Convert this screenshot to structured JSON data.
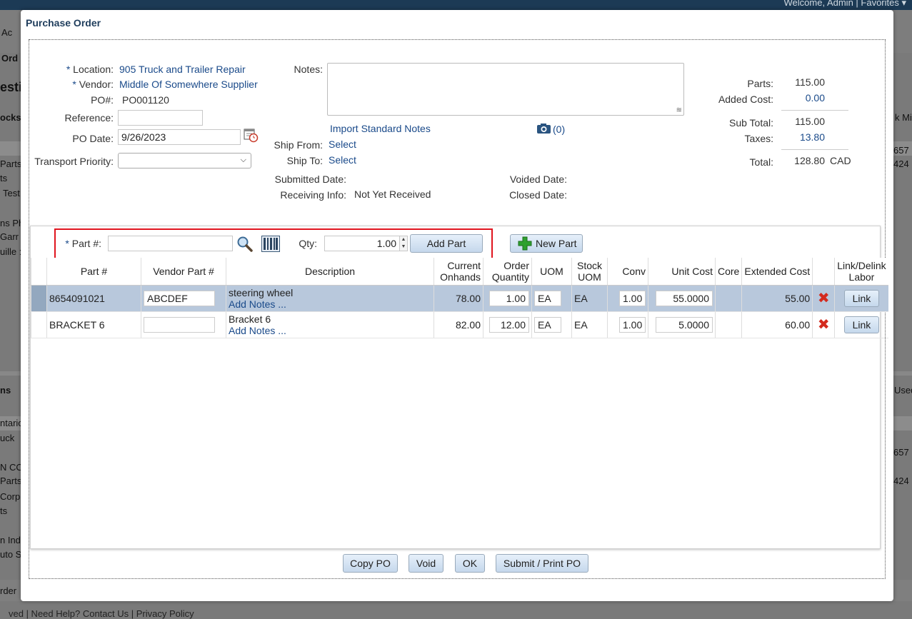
{
  "background": {
    "welcome": "Welcome, Admin  |  Favorites ▾",
    "left_texts": [
      "Ac",
      "Ord",
      "esti",
      "ocks",
      "Parts",
      "ts",
      "Test",
      "ns Ph",
      "Garr",
      "uille :",
      "ns",
      "ntario",
      "uck",
      "N CO",
      "Parts",
      "Corp",
      "ts",
      "n Ind",
      "uto S",
      "rder"
    ],
    "right_texts": [
      "k Mir",
      "657",
      "424",
      "Used",
      "657",
      "424"
    ],
    "footer": "ved  |  Need Help? Contact Us  |  Privacy Policy"
  },
  "dialog": {
    "title": "Purchase Order",
    "location_label": "Location:",
    "location_value": "905 Truck and Trailer Repair",
    "vendor_label": "Vendor:",
    "vendor_value": "Middle Of Somewhere Supplier",
    "po_label": "PO#:",
    "po_value": "PO001120",
    "reference_label": "Reference:",
    "reference_value": "",
    "po_date_label": "PO Date:",
    "po_date_value": "9/26/2023",
    "transport_label": "Transport Priority:",
    "transport_value": "",
    "notes_label": "Notes:",
    "notes_value": "",
    "import_notes": "Import Standard Notes",
    "attachments_count": "(0)",
    "ship_from_label": "Ship From:",
    "ship_from_value": "Select",
    "ship_to_label": "Ship To:",
    "ship_to_value": "Select",
    "submitted_label": "Submitted Date:",
    "submitted_value": "",
    "receiving_label": "Receiving Info:",
    "receiving_value": "Not Yet Received",
    "voided_label": "Voided Date:",
    "voided_value": "",
    "closed_label": "Closed Date:",
    "closed_value": "",
    "summary": {
      "parts_label": "Parts:",
      "parts_value": "115.00",
      "added_cost_label": "Added Cost:",
      "added_cost_value": "0.00",
      "subtotal_label": "Sub Total:",
      "subtotal_value": "115.00",
      "taxes_label": "Taxes:",
      "taxes_value": "13.80",
      "total_label": "Total:",
      "total_value": "128.80",
      "currency": "CAD"
    }
  },
  "part_entry": {
    "req_mark": "*",
    "part_label": "Part #:",
    "part_value": "",
    "qty_label": "Qty:",
    "qty_value": "1.00",
    "add_part": "Add Part",
    "new_part": "New Part"
  },
  "table": {
    "headers": {
      "part": "Part #",
      "vendor_part": "Vendor Part #",
      "description": "Description",
      "onhands_1": "Current",
      "onhands_2": "Onhands",
      "order_qty_1": "Order",
      "order_qty_2": "Quantity",
      "uom": "UOM",
      "stock_uom_1": "Stock",
      "stock_uom_2": "UOM",
      "conv": "Conv",
      "unit_cost": "Unit Cost",
      "core": "Core",
      "extended_cost": "Extended Cost",
      "link_1": "Link/Delink",
      "link_2": "Labor"
    },
    "rows": [
      {
        "part": "8654091021",
        "vendor_part": "ABCDEF",
        "description": "steering wheel",
        "add_notes": "Add Notes ...",
        "onhands": "78.00",
        "order_qty": "1.00",
        "uom": "EA",
        "stock_uom": "EA",
        "conv": "1.00",
        "unit_cost": "55.0000",
        "core": "",
        "extended": "55.00",
        "link": "Link"
      },
      {
        "part": "BRACKET 6",
        "vendor_part": "",
        "description": "Bracket 6",
        "add_notes": "Add Notes ...",
        "onhands": "82.00",
        "order_qty": "12.00",
        "uom": "EA",
        "stock_uom": "EA",
        "conv": "1.00",
        "unit_cost": "5.0000",
        "core": "",
        "extended": "60.00",
        "link": "Link"
      }
    ]
  },
  "footer_buttons": {
    "copy": "Copy PO",
    "void": "Void",
    "ok": "OK",
    "submit": "Submit / Print PO"
  },
  "colors": {
    "link": "#1a4a8a",
    "highlight": "#e0141e",
    "selected_row": "#b8c8dc",
    "title": "#1f3d5c"
  }
}
